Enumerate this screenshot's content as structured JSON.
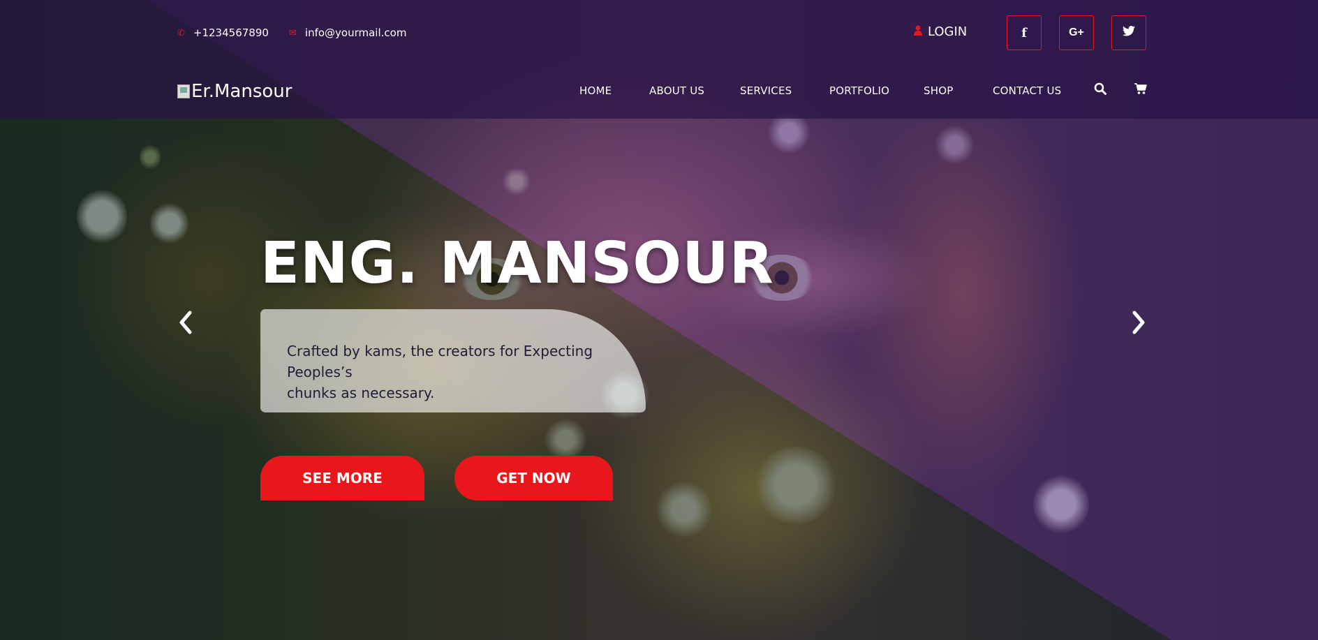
{
  "topbar": {
    "phone": "+1234567890",
    "email": "info@yourmail.com",
    "login_label": "LOGIN",
    "social": [
      {
        "icon": "facebook-icon",
        "glyph": "f"
      },
      {
        "icon": "google-plus-icon",
        "glyph": "G+"
      },
      {
        "icon": "twitter-icon",
        "glyph": "t"
      }
    ]
  },
  "brand": {
    "logo_alt": "Er.Mansour"
  },
  "nav": {
    "items": [
      "HOME",
      "ABOUT US",
      "SERVICES",
      "PORTFOLIO",
      "SHOP",
      "CONTACT US"
    ],
    "search_icon": "search-icon",
    "cart_icon": "cart-icon"
  },
  "hero": {
    "title": "ENG. MANSOUR",
    "tagline_line1": "Crafted by kams, the creators for Expecting Peoples’s",
    "tagline_line2": "chunks as necessary.",
    "buttons": {
      "see_more": "SEE MORE",
      "get_now": "GET NOW"
    },
    "prev_icon": "chevron-left-icon",
    "next_icon": "chevron-right-icon"
  },
  "colors": {
    "accent": "#e8171b",
    "header_overlay": "#28144680",
    "tagline_text": "#1f1d36"
  }
}
